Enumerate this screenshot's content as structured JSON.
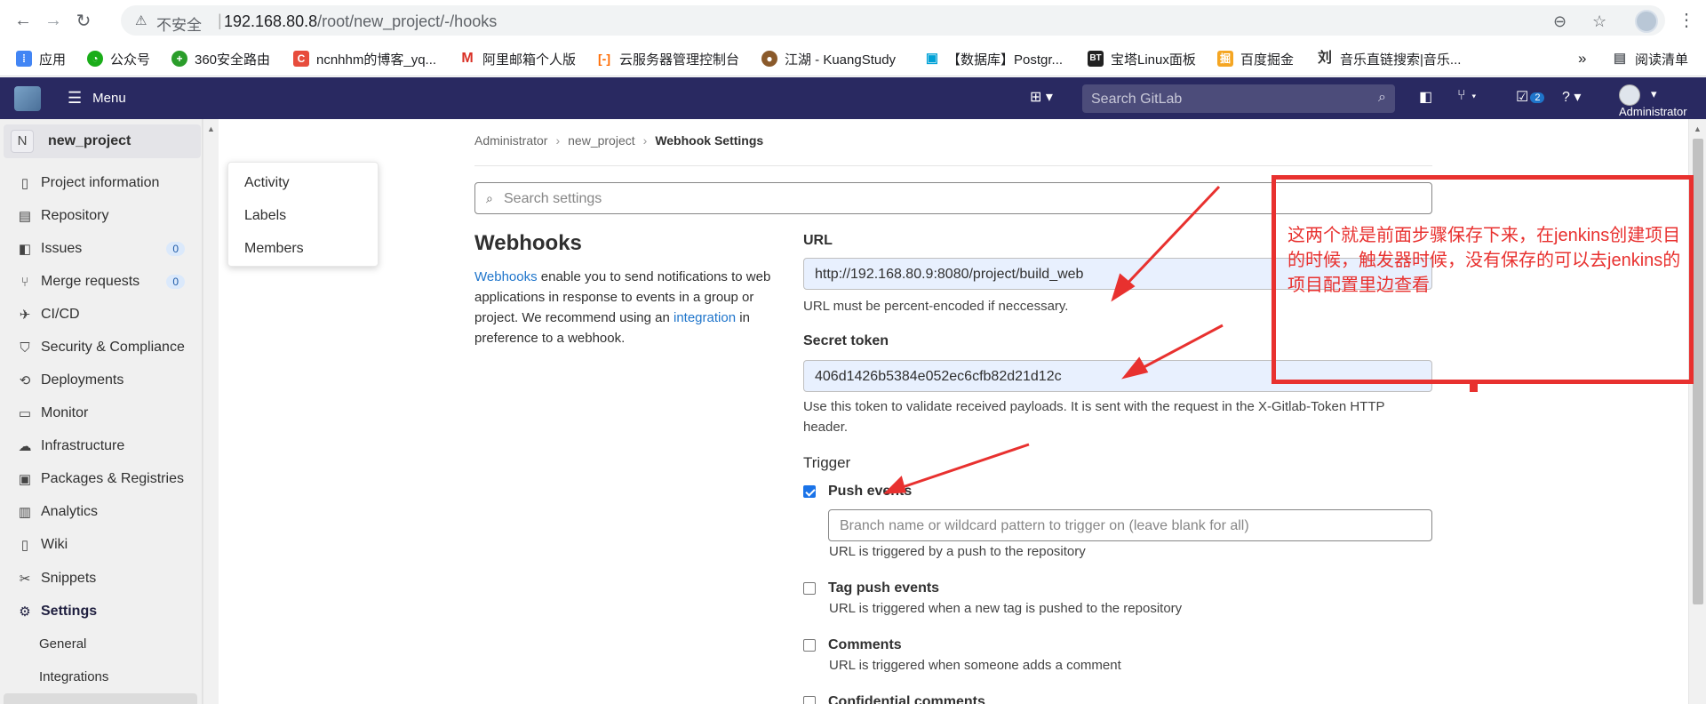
{
  "browser": {
    "insecure_label": "不安全",
    "url_host": "192.168.80.8",
    "url_path": "/root/new_project/-/hooks",
    "bookmarks": [
      {
        "label": "应用",
        "icon": "apps-grid-icon",
        "color": "#4285f4"
      },
      {
        "label": "公众号",
        "icon": "wechat-icon",
        "color": "#1aad19"
      },
      {
        "label": "360安全路由",
        "icon": "360-icon",
        "color": "#2a9d2a"
      },
      {
        "label": "ncnhhm的博客_yq...",
        "icon": "csdn-icon",
        "color": "#e74c3c"
      },
      {
        "label": "阿里邮箱个人版",
        "icon": "mail-icon",
        "color": "#d93025"
      },
      {
        "label": "云服务器管理控制台",
        "icon": "aliyun-icon",
        "color": "#ff6a00"
      },
      {
        "label": "江湖 - KuangStudy",
        "icon": "kuang-icon",
        "color": "#8a5a2b"
      },
      {
        "label": "【数据库】Postgr...",
        "icon": "bilibili-icon",
        "color": "#00a1d6"
      },
      {
        "label": "宝塔Linux面板",
        "icon": "bt-icon",
        "color": "#222222"
      },
      {
        "label": "百度掘金",
        "icon": "juejin-icon",
        "color": "#f5a623"
      },
      {
        "label": "音乐直链搜索|音乐...",
        "icon": "music-icon",
        "color": "#333333"
      }
    ],
    "more_label": "»",
    "reading_list": "阅读清单"
  },
  "gitlab_nav": {
    "menu_label": "Menu",
    "search_placeholder": "Search GitLab",
    "todo_count": "2",
    "user_name": "Administrator"
  },
  "sidebar": {
    "project_initial": "N",
    "project_name": "new_project",
    "items": [
      {
        "label": "Project information",
        "icon": "info-icon"
      },
      {
        "label": "Repository",
        "icon": "book-icon"
      },
      {
        "label": "Issues",
        "icon": "issues-icon",
        "count": "0"
      },
      {
        "label": "Merge requests",
        "icon": "merge-request-icon",
        "count": "0"
      },
      {
        "label": "CI/CD",
        "icon": "rocket-icon"
      },
      {
        "label": "Security & Compliance",
        "icon": "shield-icon"
      },
      {
        "label": "Deployments",
        "icon": "deployments-icon"
      },
      {
        "label": "Monitor",
        "icon": "monitor-icon"
      },
      {
        "label": "Infrastructure",
        "icon": "cloud-icon"
      },
      {
        "label": "Packages & Registries",
        "icon": "package-icon"
      },
      {
        "label": "Analytics",
        "icon": "chart-icon"
      },
      {
        "label": "Wiki",
        "icon": "wiki-icon"
      },
      {
        "label": "Snippets",
        "icon": "snippet-icon"
      },
      {
        "label": "Settings",
        "icon": "gear-icon"
      }
    ],
    "sub_items": [
      "General",
      "Integrations"
    ]
  },
  "popover": {
    "items": [
      "Activity",
      "Labels",
      "Members"
    ]
  },
  "breadcrumb": [
    "Administrator",
    "new_project",
    "Webhook Settings"
  ],
  "search_settings_placeholder": "Search settings",
  "webhooks": {
    "title": "Webhooks",
    "desc_link1": "Webhooks",
    "desc_part1": " enable you to send notifications to web applications in response to events in a group or project. We recommend using an ",
    "desc_link2": "integration",
    "desc_part2": " in preference to a webhook."
  },
  "form": {
    "url_label": "URL",
    "url_value": "http://192.168.80.9:8080/project/build_web",
    "url_help": "URL must be percent-encoded if neccessary.",
    "token_label": "Secret token",
    "token_value": "406d1426b5384e052ec6cfb82d21d12c",
    "token_help": "Use this token to validate received payloads. It is sent with the request in the X-Gitlab-Token HTTP header.",
    "trigger_label": "Trigger",
    "triggers": [
      {
        "label": "Push events",
        "checked": true,
        "help": "URL is triggered by a push to the repository"
      },
      {
        "label": "Tag push events",
        "checked": false,
        "help": "URL is triggered when a new tag is pushed to the repository"
      },
      {
        "label": "Comments",
        "checked": false,
        "help": "URL is triggered when someone adds a comment"
      },
      {
        "label": "Confidential comments",
        "checked": false,
        "help": ""
      }
    ],
    "branch_placeholder": "Branch name or wildcard pattern to trigger on (leave blank for all)"
  },
  "annotation": {
    "text": "这两个就是前面步骤保存下来，在jenkins创建项目的时候，触发器时候，没有保存的可以去jenkins的项目配置里边查看",
    "color": "#e8312f"
  }
}
